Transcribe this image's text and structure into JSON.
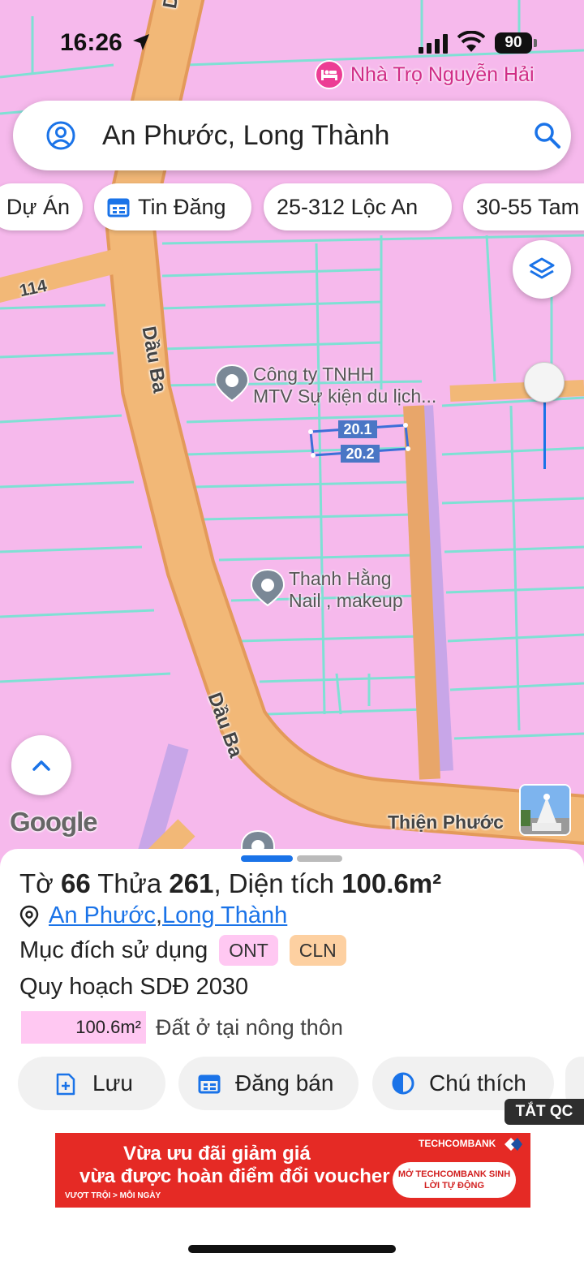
{
  "status_bar": {
    "time": "16:26",
    "battery": "90"
  },
  "map": {
    "poi_hotel": {
      "label": "Nhà Trọ Nguyễn Hải",
      "icon": "bed-icon"
    },
    "poi_company": {
      "line1": "Công ty TNHH",
      "line2": "MTV Sự kiện du lịch..."
    },
    "poi_nail": {
      "line1": "Thanh Hằng",
      "line2": "Nail , makeup"
    },
    "road_labels": {
      "top": "Dầu",
      "main": "Dầu Ba",
      "lower": "Dầu Ba",
      "route": "114"
    },
    "parcels": [
      "20.1",
      "20.2"
    ],
    "google_logo": "Google",
    "place_label": "Thiện Phước"
  },
  "search": {
    "query": "An Phước, Long Thành"
  },
  "chips": [
    {
      "label": "Dự Án"
    },
    {
      "label": "Tin Đăng"
    },
    {
      "label": "25-312 Lộc An"
    },
    {
      "label": "30-55 Tam"
    }
  ],
  "sheet": {
    "title_prefix": "Tờ ",
    "sheet_no": "66",
    "title_mid": " Thửa ",
    "plot_no": "261",
    "title_area_label": ", Diện tích ",
    "area": "100.6m²",
    "address_commune": "An Phước",
    "address_sep": ", ",
    "address_district": "Long Thành",
    "usage_label": "Mục đích sử dụng",
    "tags": [
      "ONT",
      "CLN"
    ],
    "plan_label": "Quy hoạch SDĐ 2030",
    "plan_area": "100.6m²",
    "plan_desc": "Đất ở tại nông thôn"
  },
  "actions": [
    {
      "label": "Lưu",
      "icon": "save-doc-icon"
    },
    {
      "label": "Đăng bán",
      "icon": "calendar-icon"
    },
    {
      "label": "Chú thích",
      "icon": "legend-icon"
    }
  ],
  "ad": {
    "close_label": "TẮT QC",
    "line1": "Vừa ưu đãi giảm giá",
    "line2": "vừa được hoàn điểm đổi voucher",
    "brand": "TECHCOMBANK",
    "cta": "MỞ TECHCOMBANK SINH LỜI TỰ ĐỘNG",
    "slogan": "VƯỢT TRỘI > MỖI NGÀY"
  },
  "colors": {
    "land_residential": "#f6b9ec",
    "road": "#f2b877",
    "parcel_line": "#7fe0d4",
    "accent": "#1a73e8",
    "ad_red": "#e52a25"
  }
}
